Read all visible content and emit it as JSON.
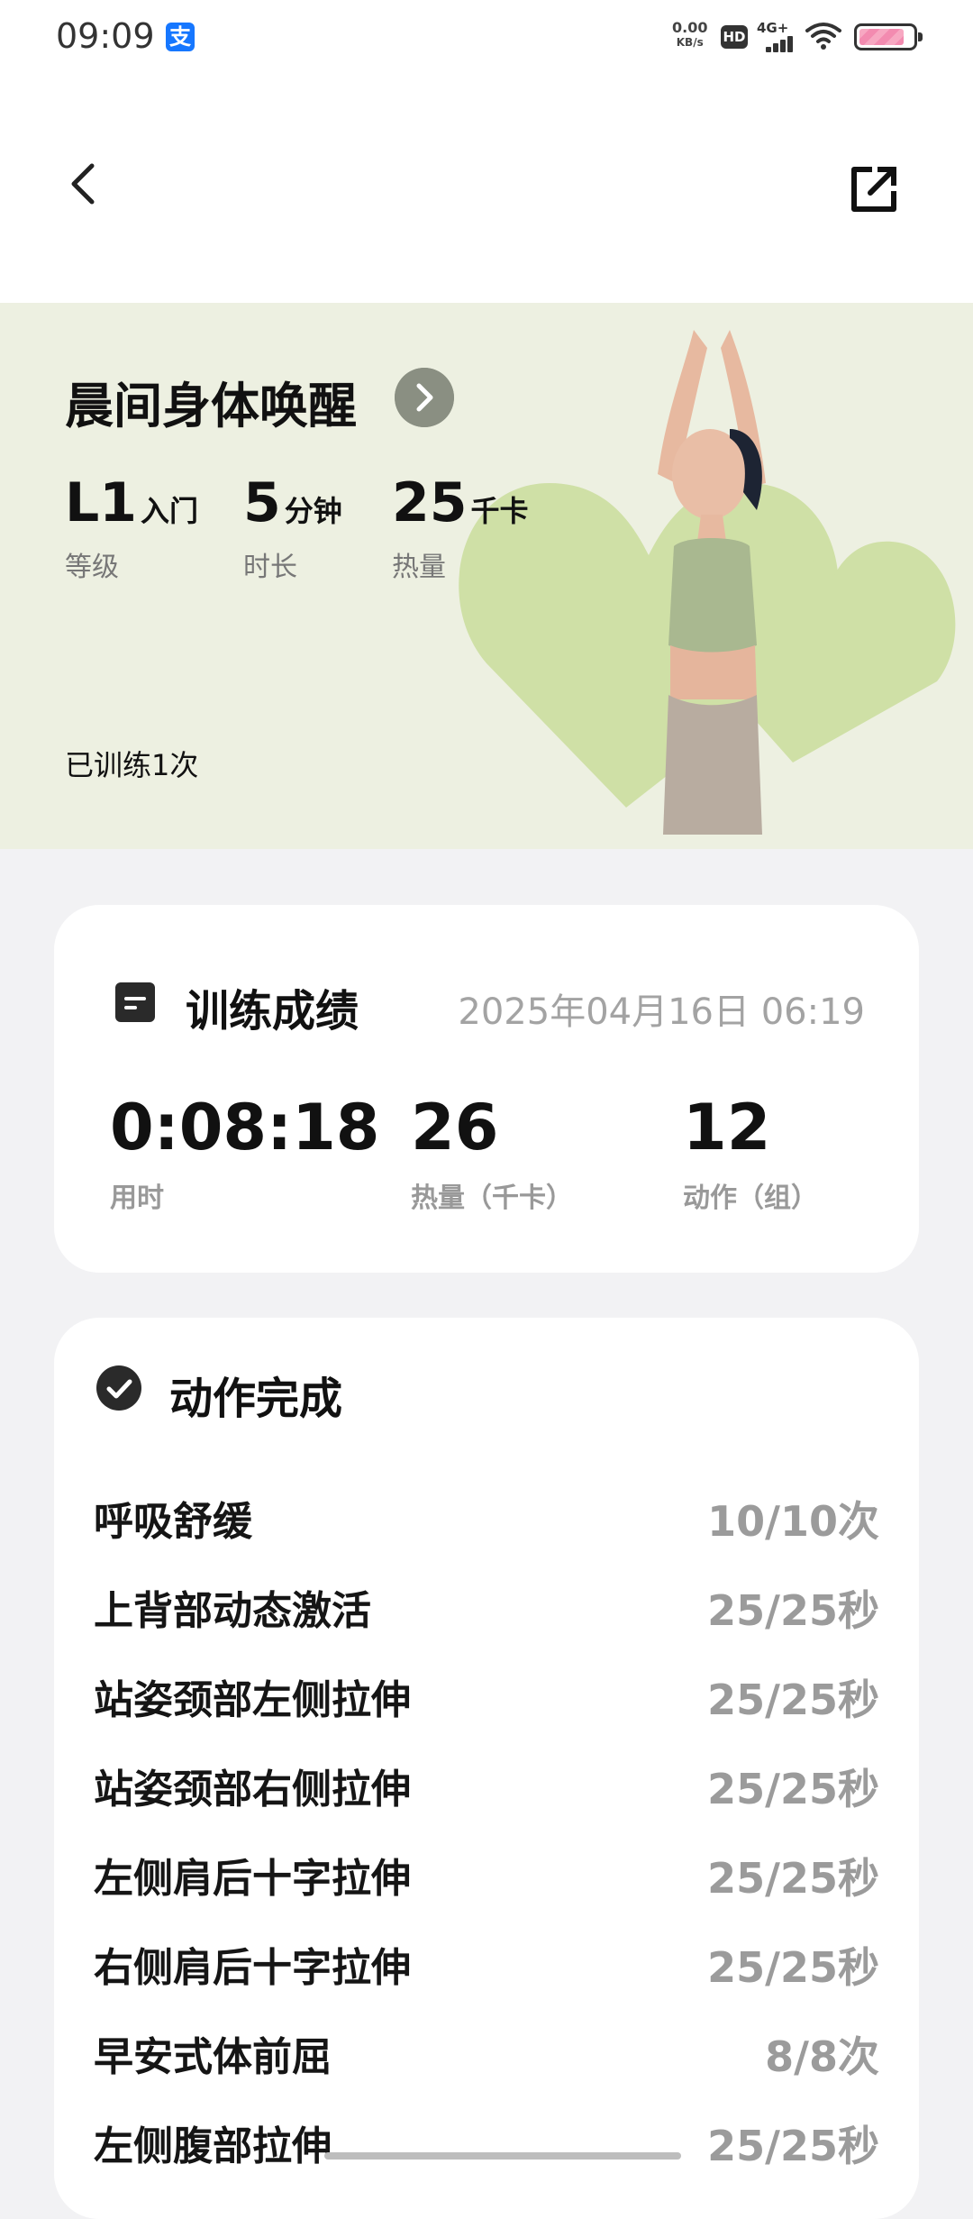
{
  "status_bar": {
    "time": "09:09",
    "app_icon": "支",
    "net_speed_value": "0.00",
    "net_speed_unit": "KB/s",
    "hd": "HD",
    "network": "4G+"
  },
  "hero": {
    "title": "晨间身体唤醒",
    "stats": [
      {
        "value": "L1",
        "unit": "入门",
        "label": "等级"
      },
      {
        "value": "5",
        "unit": "分钟",
        "label": "时长"
      },
      {
        "value": "25",
        "unit": "千卡",
        "label": "热量"
      }
    ],
    "trained_text": "已训练1次",
    "colors": {
      "background": "#edf0e1",
      "heart": "#cfe0a6"
    }
  },
  "results": {
    "title": "训练成绩",
    "datetime": "2025年04月16日 06:19",
    "metrics": [
      {
        "value": "0:08:18",
        "label": "用时"
      },
      {
        "value": "26",
        "label": "热量（千卡）"
      },
      {
        "value": "12",
        "label": "动作（组）"
      }
    ]
  },
  "actions": {
    "title": "动作完成",
    "items": [
      {
        "name": "呼吸舒缓",
        "count": "10/10次"
      },
      {
        "name": "上背部动态激活",
        "count": "25/25秒"
      },
      {
        "name": "站姿颈部左侧拉伸",
        "count": "25/25秒"
      },
      {
        "name": "站姿颈部右侧拉伸",
        "count": "25/25秒"
      },
      {
        "name": "左侧肩后十字拉伸",
        "count": "25/25秒"
      },
      {
        "name": "右侧肩后十字拉伸",
        "count": "25/25秒"
      },
      {
        "name": "早安式体前屈",
        "count": "8/8次"
      },
      {
        "name": "左侧腹部拉伸",
        "count": "25/25秒"
      }
    ]
  },
  "icons": {
    "back": "back-arrow-icon",
    "share": "share-icon",
    "hero_arrow": "chevron-right-icon",
    "results": "document-icon",
    "actions": "check-circle-icon"
  },
  "battery_level": 0.85
}
